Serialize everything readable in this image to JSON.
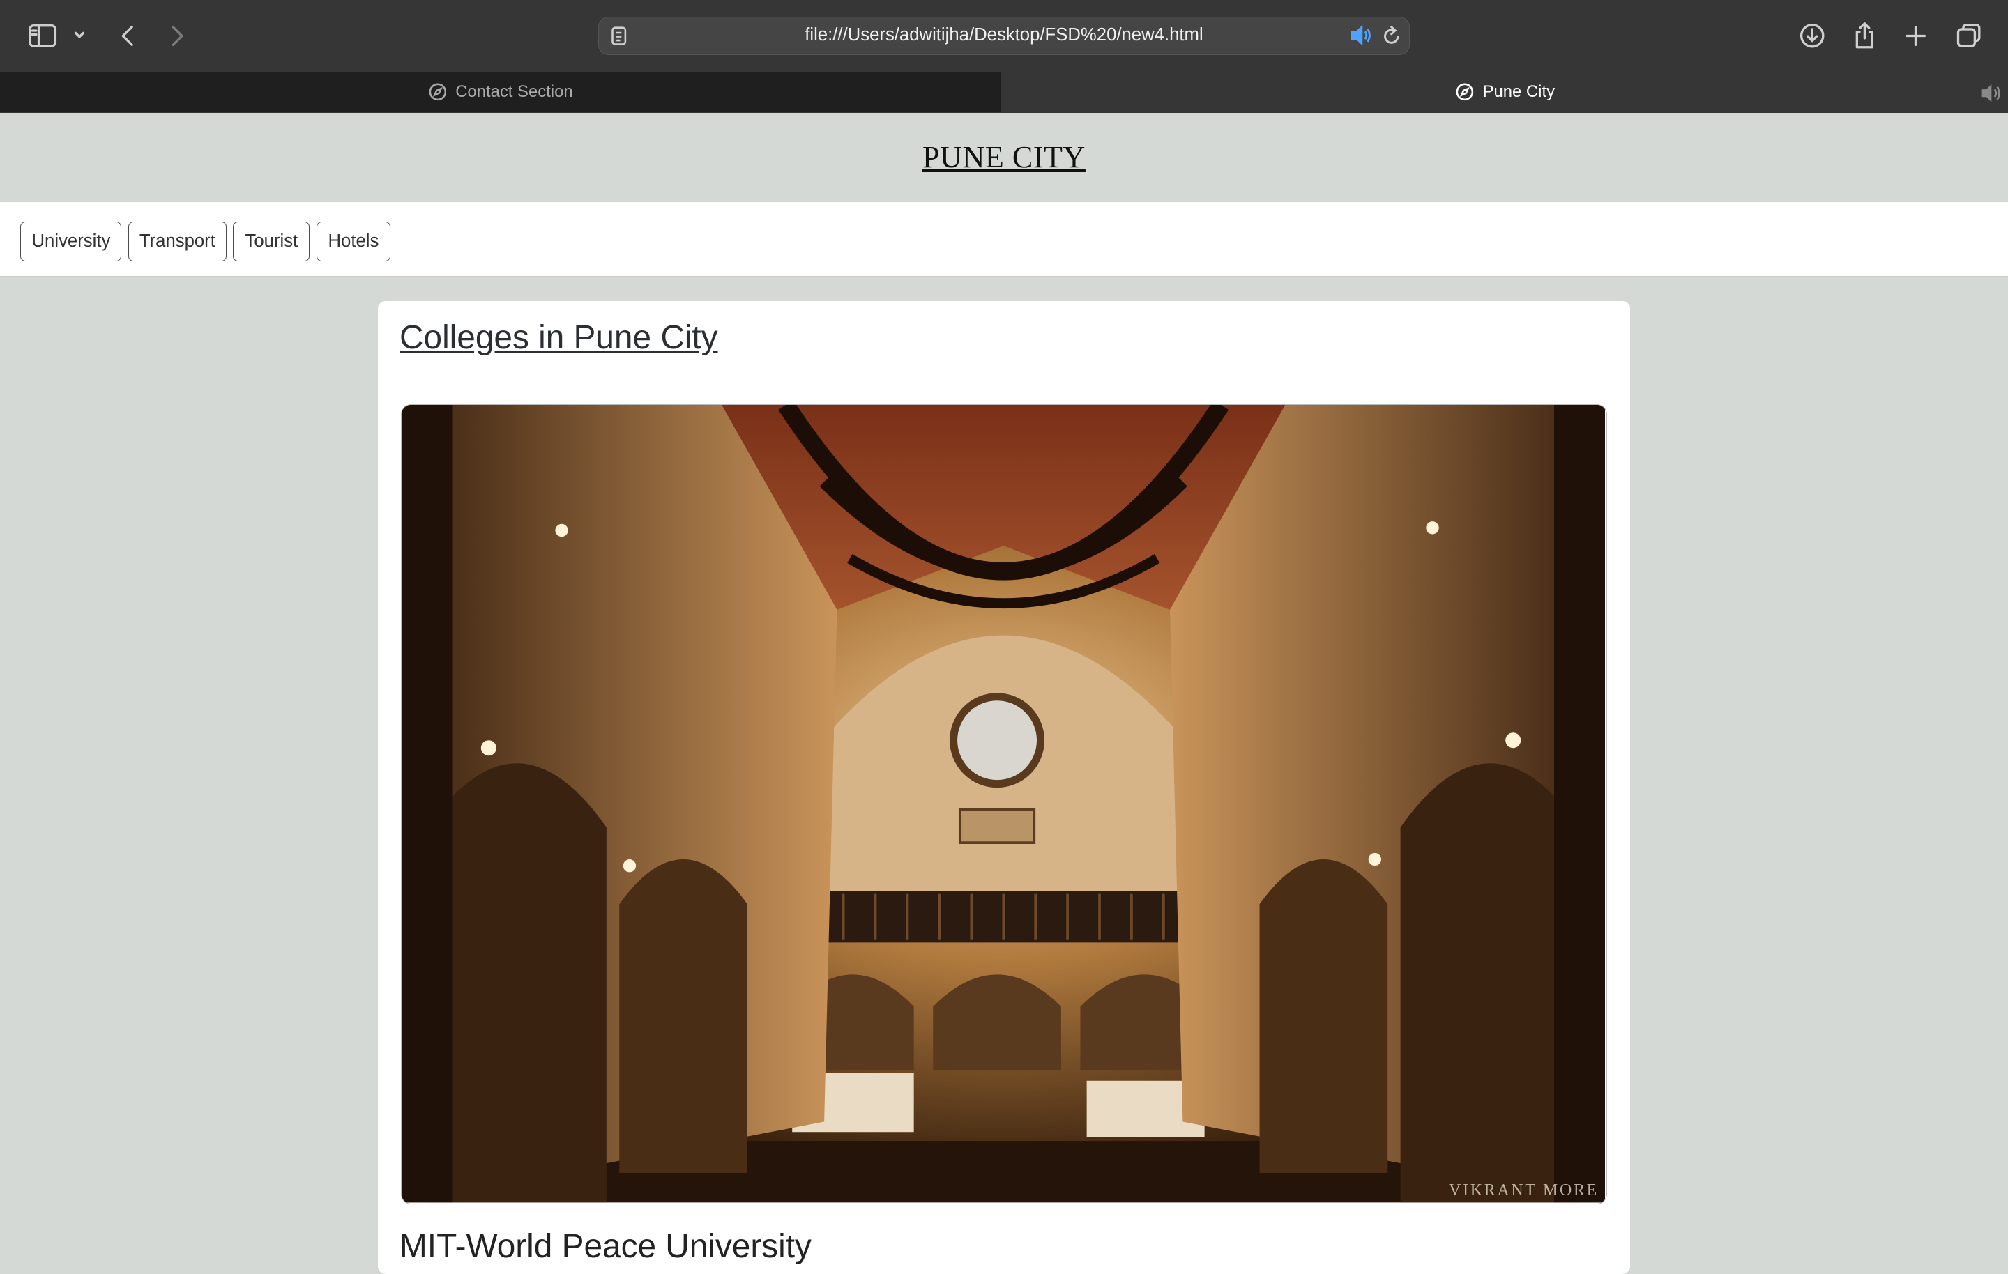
{
  "browser": {
    "url": "file:///Users/adwitijha/Desktop/FSD%20/new4.html",
    "tabs": [
      {
        "label": "Contact Section",
        "active": false
      },
      {
        "label": "Pune City",
        "active": true
      }
    ],
    "icons": [
      "sidebar-icon",
      "chevron-down-icon",
      "back-icon",
      "forward-icon",
      "reader-icon",
      "speaker-icon",
      "reload-icon",
      "download-icon",
      "share-icon",
      "new-tab-icon",
      "tab-overview-icon"
    ]
  },
  "page": {
    "title": "PUNE CITY",
    "nav": [
      "University",
      "Transport",
      "Tourist",
      "Hotels"
    ],
    "section": {
      "heading": "Colleges in Pune City",
      "image_watermark": "VIKRANT MORE",
      "first_item": "MIT-World Peace University"
    }
  },
  "colors": {
    "chrome": "#363637",
    "page_background": "#d4d9d5",
    "card_background": "#ffffff"
  }
}
